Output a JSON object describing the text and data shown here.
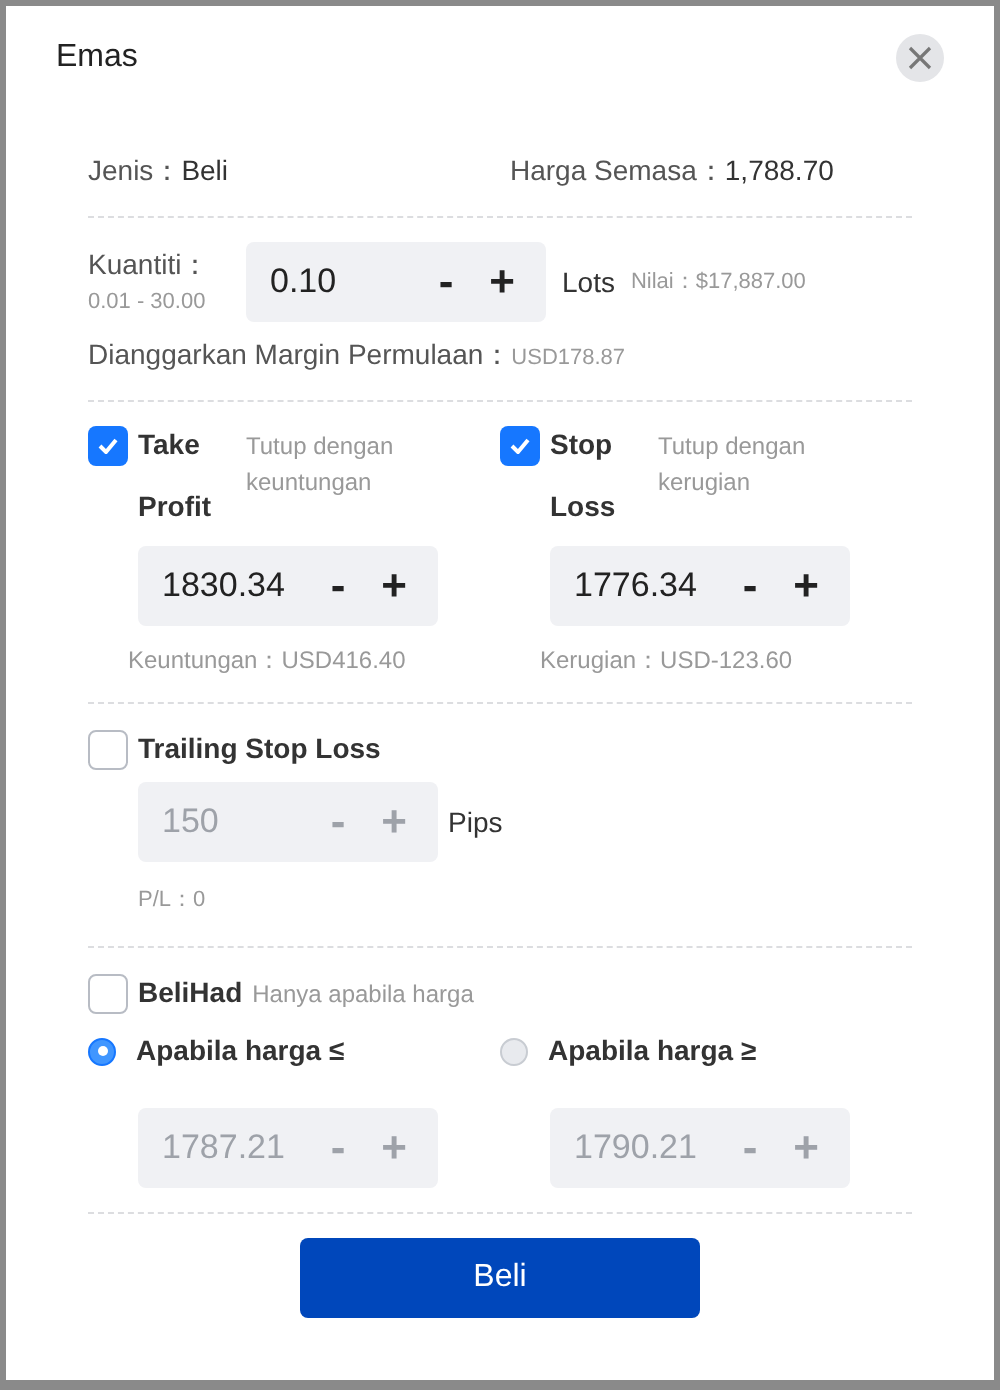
{
  "title": "Emas",
  "info": {
    "type_label": "Jenis：",
    "type_value": "Beli",
    "price_label": "Harga Semasa：",
    "price_value": "1,788.70"
  },
  "quantity": {
    "label": "Kuantiti：",
    "range": "0.01 - 30.00",
    "stepper": {
      "value": "0.10",
      "minus": "-",
      "plus": "+",
      "disabled": false
    },
    "unit": "Lots",
    "value_text": "Nilai：$17,887.00"
  },
  "margin": {
    "label": "Dianggarkan Margin Permulaan：",
    "value": "USD178.87"
  },
  "tp_sl": [
    {
      "label": "Take Profit",
      "hint": "Tutup dengan keuntungan",
      "checked": true,
      "stepper": {
        "value": "1830.34",
        "minus": "-",
        "plus": "+",
        "disabled": false
      },
      "result": "Keuntungan：USD416.40"
    },
    {
      "label": "Stop Loss",
      "hint": "Tutup dengan kerugian",
      "checked": true,
      "stepper": {
        "value": "1776.34",
        "minus": "-",
        "plus": "+",
        "disabled": false
      },
      "result": "Kerugian：USD-123.60"
    }
  ],
  "trailing": {
    "label": "Trailing Stop Loss",
    "checked": false,
    "stepper": {
      "value": "150",
      "minus": "-",
      "plus": "+",
      "disabled": true
    },
    "unit": "Pips",
    "pl": "P/L：0"
  },
  "limit": {
    "label": "BeliHad",
    "hint": "Hanya apabila harga",
    "checked": false,
    "options": [
      {
        "label": "Apabila harga ≤",
        "selected": true,
        "stepper": {
          "value": "1787.21",
          "minus": "-",
          "plus": "+",
          "disabled": true
        }
      },
      {
        "label": "Apabila harga ≥",
        "selected": false,
        "stepper": {
          "value": "1790.21",
          "minus": "-",
          "plus": "+",
          "disabled": true
        }
      }
    ]
  },
  "submit": "Beli"
}
